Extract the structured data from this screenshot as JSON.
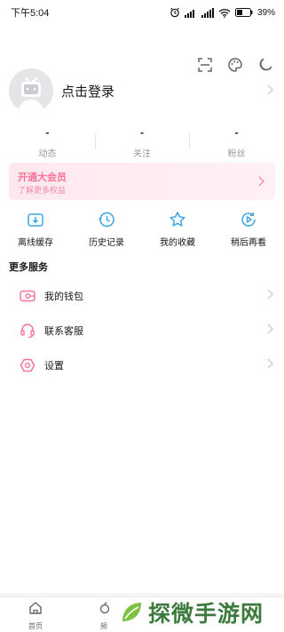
{
  "status_bar": {
    "time": "下午5:04",
    "battery": "39%"
  },
  "profile": {
    "login_label": "点击登录"
  },
  "stats": [
    {
      "value": "-",
      "label": "动态"
    },
    {
      "value": "-",
      "label": "关注"
    },
    {
      "value": "-",
      "label": "粉丝"
    }
  ],
  "vip": {
    "title": "开通大会员",
    "subtitle": "了解更多权益"
  },
  "quick_actions": [
    {
      "label": "离线缓存",
      "icon": "download-icon"
    },
    {
      "label": "历史记录",
      "icon": "history-icon"
    },
    {
      "label": "我的收藏",
      "icon": "star-icon"
    },
    {
      "label": "稍后再看",
      "icon": "watch-later-icon"
    }
  ],
  "services": {
    "title": "更多服务",
    "items": [
      {
        "label": "我的钱包",
        "icon": "wallet-icon"
      },
      {
        "label": "联系客服",
        "icon": "headset-icon"
      },
      {
        "label": "设置",
        "icon": "settings-icon"
      }
    ]
  },
  "tabbar": {
    "tabs": [
      {
        "label": "首页",
        "icon": "home-icon"
      },
      {
        "label": "频",
        "icon": "channel-icon"
      }
    ]
  },
  "watermark": {
    "text": "探微手游网"
  },
  "colors": {
    "accent": "#fb7299",
    "icon_blue": "#3aa5e3",
    "text": "#18191c",
    "muted": "#9499a0"
  }
}
